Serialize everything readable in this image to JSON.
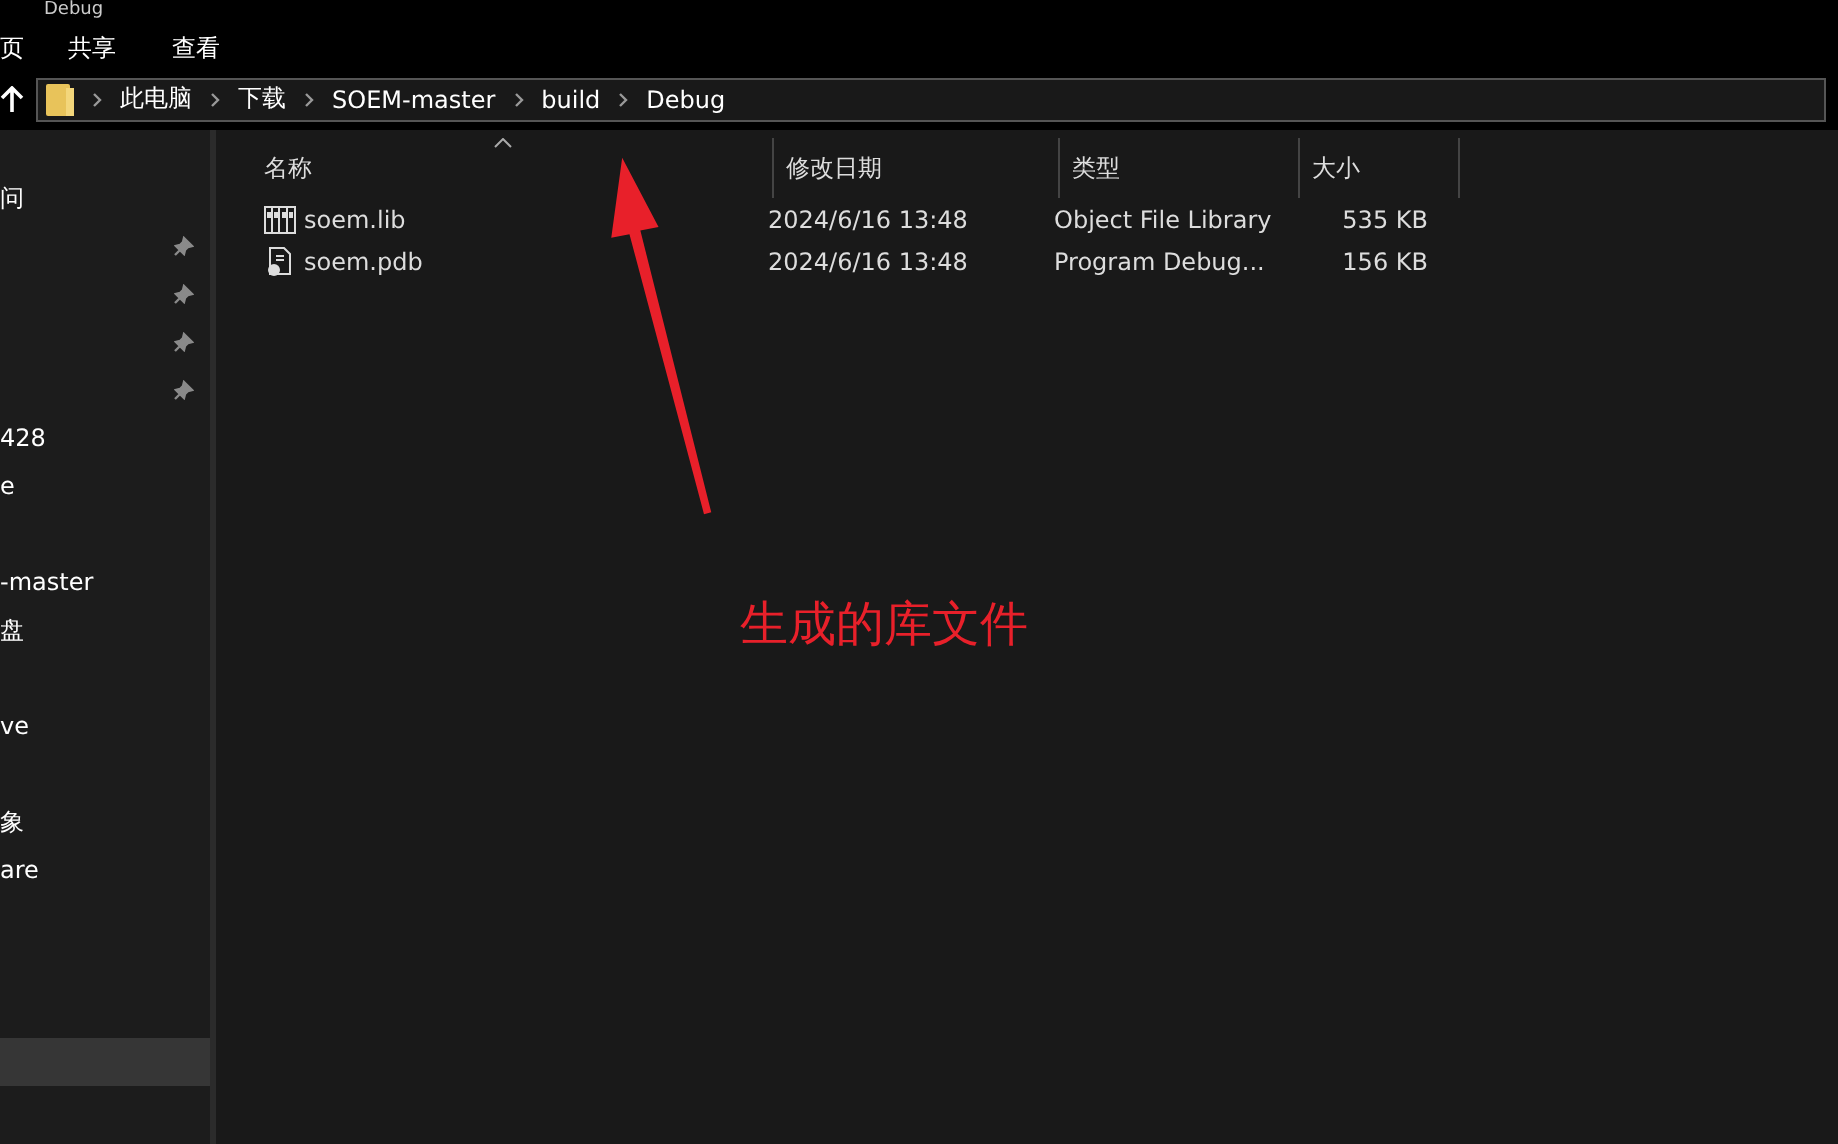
{
  "window": {
    "title": "Debug"
  },
  "menu": [
    "页",
    "共享",
    "查看"
  ],
  "breadcrumbs": [
    "此电脑",
    "下载",
    "SOEM-master",
    "build",
    "Debug"
  ],
  "sidebar": {
    "items": [
      {
        "label": "问",
        "pinned": false,
        "selected": false
      },
      {
        "pinned": true,
        "selected": false
      },
      {
        "pinned": true,
        "selected": false
      },
      {
        "pinned": true,
        "selected": false
      },
      {
        "pinned": true,
        "selected": false
      },
      {
        "label": "428",
        "pinned": false,
        "selected": false
      },
      {
        "label": "e",
        "pinned": false,
        "selected": false
      },
      {
        "pinned": false,
        "selected": false
      },
      {
        "label": "-master",
        "pinned": false,
        "selected": false
      },
      {
        "label": "盘",
        "pinned": false,
        "selected": false
      },
      {
        "pinned": false,
        "selected": false
      },
      {
        "label": "ve",
        "pinned": false,
        "selected": false
      },
      {
        "pinned": false,
        "selected": false
      },
      {
        "label": "象",
        "pinned": false,
        "selected": false
      },
      {
        "label": "are",
        "pinned": false,
        "selected": false
      },
      {
        "pinned": false,
        "selected": false
      },
      {
        "pinned": false,
        "selected": false
      },
      {
        "pinned": false,
        "selected": false
      },
      {
        "pinned": false,
        "selected": true
      }
    ]
  },
  "table": {
    "columns": [
      "名称",
      "修改日期",
      "类型",
      "大小"
    ],
    "rows": [
      {
        "kind": "library",
        "name": "soem.lib",
        "modified": "2024/6/16 13:48",
        "type": "Object File Library",
        "size": "535 KB"
      },
      {
        "kind": "debug",
        "name": "soem.pdb",
        "modified": "2024/6/16 13:48",
        "type": "Program Debug...",
        "size": "156 KB"
      }
    ]
  },
  "annotation": {
    "text": "生成的库文件"
  }
}
